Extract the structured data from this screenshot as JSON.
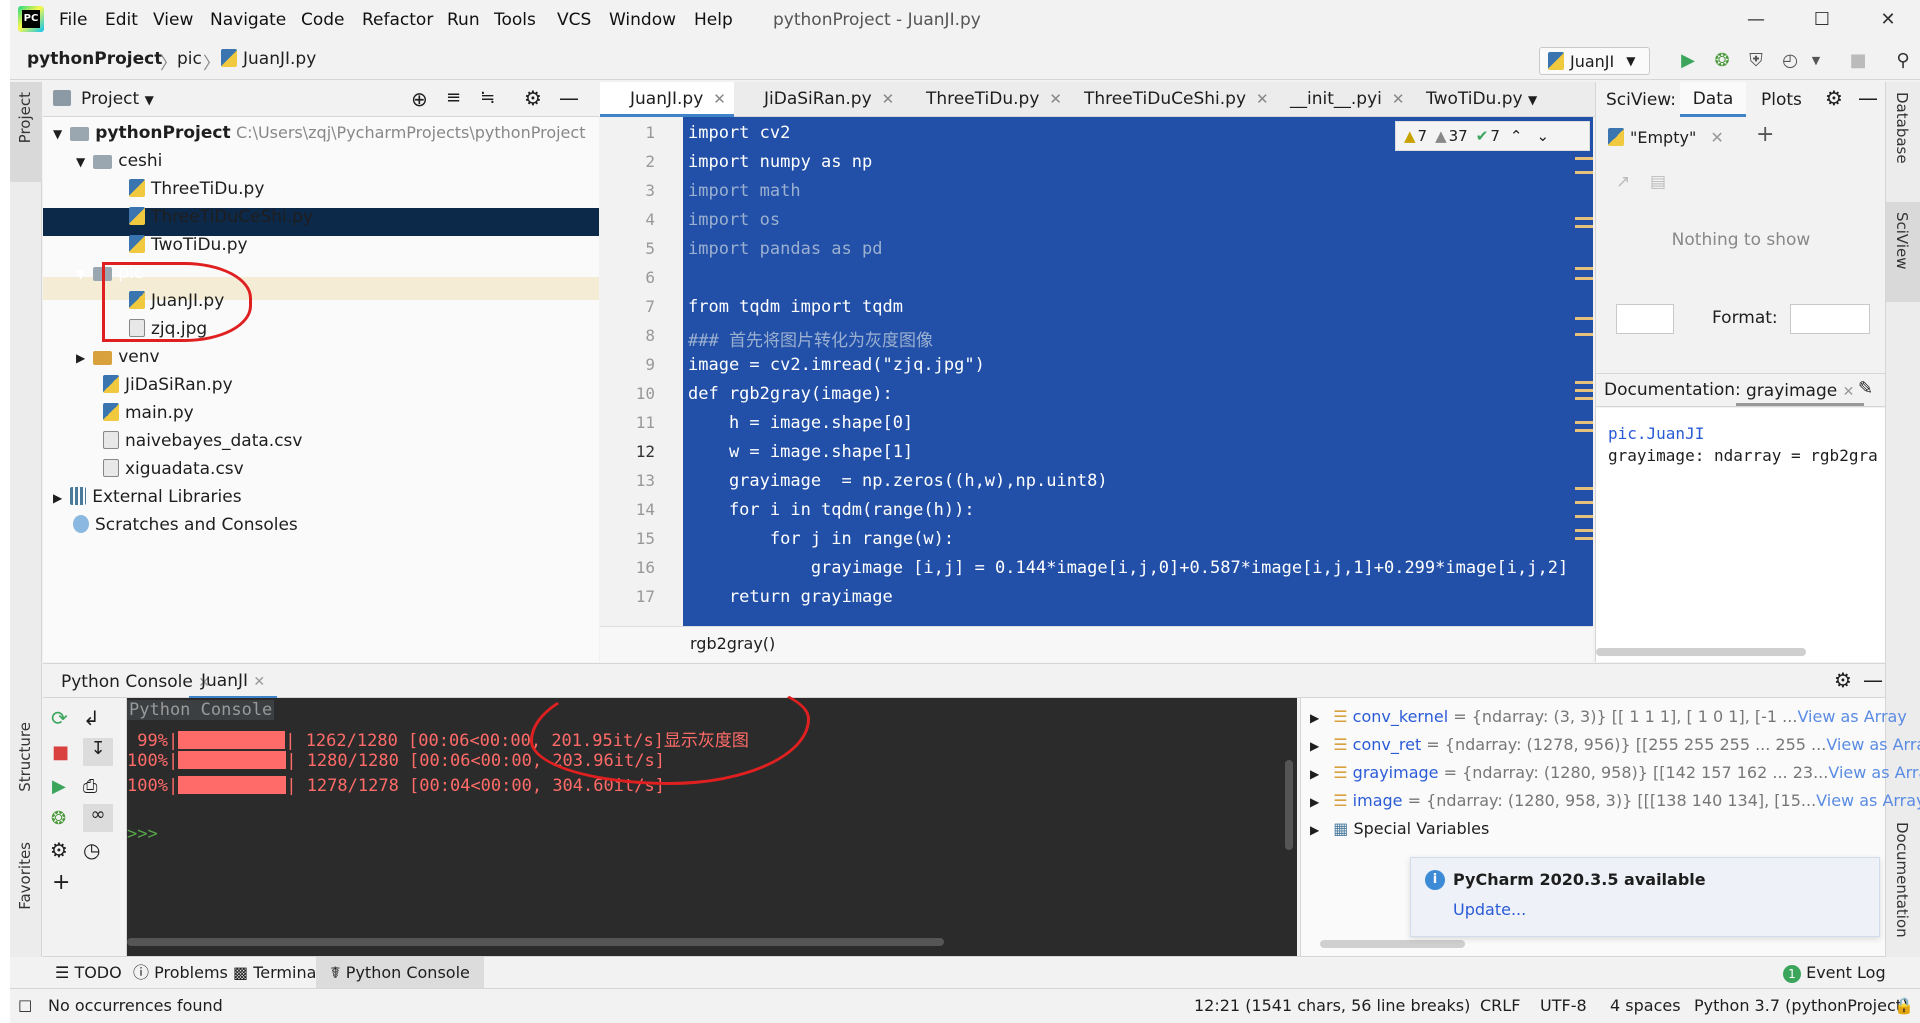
{
  "app": {
    "logo_text": "PC",
    "window_title": "pythonProject - JuanJI.py",
    "menu": [
      "File",
      "Edit",
      "View",
      "Navigate",
      "Code",
      "Refactor",
      "Run",
      "Tools",
      "VCS",
      "Window",
      "Help"
    ]
  },
  "navbar": {
    "breadcrumb": [
      "pythonProject",
      "pic",
      "JuanJI.py"
    ],
    "run_config": "JuanJI"
  },
  "left_strip": {
    "project": "Project",
    "structure": "Structure",
    "favorites": "Favorites"
  },
  "right_strip": {
    "database": "Database",
    "sciview": "SciView",
    "documentation": "Documentation"
  },
  "project_panel": {
    "title": "Project",
    "tree": [
      {
        "label": "pythonProject",
        "path": "C:\\Users\\zqj\\PycharmProjects\\pythonProject",
        "type": "folder",
        "expanded": true
      },
      {
        "label": "ceshi",
        "type": "folder",
        "expanded": true
      },
      {
        "label": "ThreeTiDu.py",
        "type": "py"
      },
      {
        "label": "ThreeTiDuCeShi.py",
        "type": "py"
      },
      {
        "label": "TwoTiDu.py",
        "type": "py"
      },
      {
        "label": "pic",
        "type": "folder",
        "expanded": true,
        "selected": true
      },
      {
        "label": "JuanJI.py",
        "type": "py"
      },
      {
        "label": "zjq.jpg",
        "type": "image"
      },
      {
        "label": "venv",
        "type": "folder",
        "expanded": false
      },
      {
        "label": "JiDaSiRan.py",
        "type": "py"
      },
      {
        "label": "main.py",
        "type": "py"
      },
      {
        "label": "naivebayes_data.csv",
        "type": "csv"
      },
      {
        "label": "xiguadata.csv",
        "type": "csv"
      },
      {
        "label": "External Libraries",
        "type": "lib"
      },
      {
        "label": "Scratches and Consoles",
        "type": "scratch"
      }
    ]
  },
  "editor": {
    "tabs": [
      "JuanJI.py",
      "JiDaSiRan.py",
      "ThreeTiDu.py",
      "ThreeTiDuCeShi.py",
      "__init__.pyi",
      "TwoTiDu.py"
    ],
    "active_tab": "JuanJI.py",
    "inspections": {
      "warnings": "7",
      "weak_warnings": "37",
      "typos": "7"
    },
    "line_numbers": [
      "1",
      "2",
      "3",
      "4",
      "5",
      "6",
      "7",
      "8",
      "9",
      "10",
      "11",
      "12",
      "13",
      "14",
      "15",
      "16",
      "17"
    ],
    "current_line": "12",
    "lines": [
      "import cv2",
      "import numpy as np",
      "import math",
      "import os",
      "import pandas as pd",
      "",
      "from tqdm import tqdm",
      "### 首先将图片转化为灰度图像",
      "image = cv2.imread(\"zjq.jpg\")",
      "def rgb2gray(image):",
      "    h = image.shape[0]",
      "    w = image.shape[1]",
      "    grayimage  = np.zeros((h,w),np.uint8)",
      "    for i in tqdm(range(h)):",
      "        for j in range(w):",
      "            grayimage [i,j] = 0.144*image[i,j,0]+0.587*image[i,j,1]+0.299*image[i,j,2]",
      "    return grayimage"
    ],
    "breadcrumb": "rgb2gray()"
  },
  "sciview": {
    "label": "SciView:",
    "tabs": [
      "Data",
      "Plots"
    ],
    "active_tab": "Data",
    "data_tab": "\"Empty\"",
    "empty_text": "Nothing to show",
    "format_label": "Format:",
    "documentation_label": "Documentation:",
    "documentation_tab": "grayimage",
    "doc_module": "pic.JuanJI",
    "doc_signature": "grayimage: ndarray = rgb2gra"
  },
  "bottom_panel": {
    "tabs": [
      "Python Console",
      "JuanJI"
    ],
    "active_tab": "JuanJI",
    "console_header": "Python Console",
    "output": [
      {
        "pct": " 99%",
        "progress": 0.99,
        "text": " 1262/1280 [00:06<00:00, 201.95it/s]",
        "note": "显示灰度图"
      },
      {
        "pct": "100%",
        "progress": 1.0,
        "text": " 1280/1280 [00:06<00:00, 203.96it/s]",
        "note": ""
      },
      {
        "pct": "100%",
        "progress": 1.0,
        "text": " 1278/1278 [00:04<00:00, 304.60it/s]",
        "note": ""
      }
    ],
    "prompt": ">>>",
    "variables": [
      {
        "name": "conv_kernel",
        "value": " = {ndarray: (3, 3)} [[ 1  1  1], [ 1  0  1], [-1 ...",
        "link": "View as Array"
      },
      {
        "name": "conv_ret",
        "value": " = {ndarray: (1278, 956)} [[255 255 255 ... 255 ...",
        "link": "View as Array"
      },
      {
        "name": "grayimage",
        "value": " = {ndarray: (1280, 958)} [[142 157 162 ... 23...",
        "link": "View as Array"
      },
      {
        "name": "image",
        "value": " = {ndarray: (1280, 958, 3)} [[[138 140 134],  [15...",
        "link": "View as Array"
      },
      {
        "name": "Special Variables",
        "value": "",
        "link": ""
      }
    ],
    "notification": {
      "title": "PyCharm 2020.3.5 available",
      "action": "Update..."
    }
  },
  "tool_tabs": [
    "TODO",
    "Problems",
    "Terminal",
    "Python Console"
  ],
  "tool_tabs_active": "Python Console",
  "event_log": {
    "count": "1",
    "label": "Event Log"
  },
  "status": {
    "message": "No occurrences found",
    "position": "12:21 (1541 chars, 56 line breaks)",
    "line_sep": "CRLF",
    "encoding": "UTF-8",
    "indent": "4 spaces",
    "interpreter": "Python 3.7 (pythonProject)"
  },
  "colors": {
    "selection": "#2250a8",
    "console_bg": "#2b2b2b",
    "console_red": "#ff6b68",
    "accent": "#4083c9",
    "annotation_red": "#e02020"
  }
}
